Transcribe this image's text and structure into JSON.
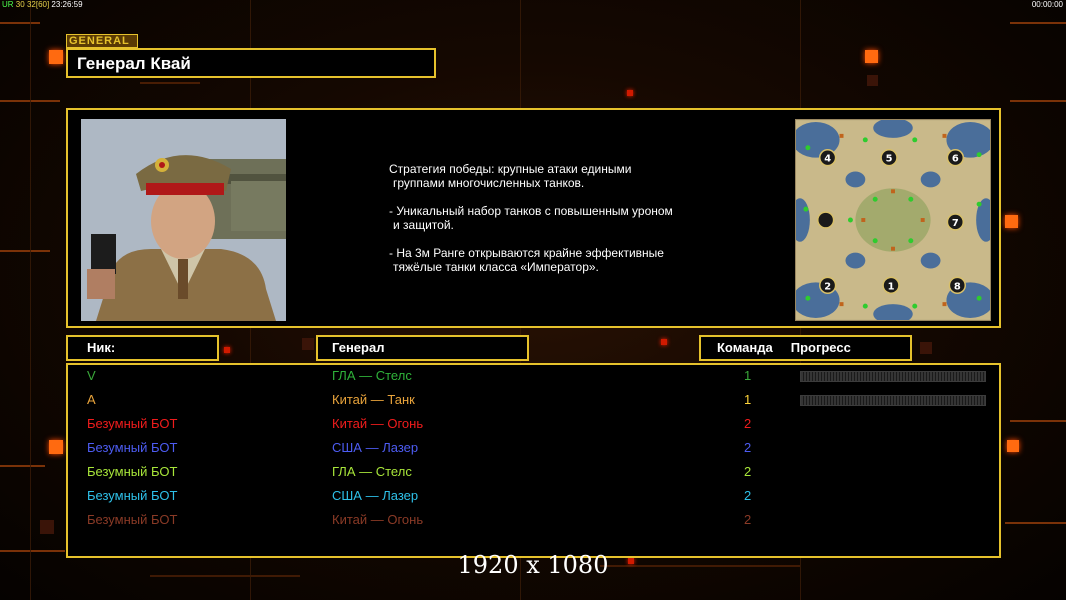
{
  "hud": {
    "counter_label": "UR",
    "counter_a": "30",
    "counter_b": "32",
    "counter_c": "[60]",
    "clock": "23:26:59",
    "timer": "00:00:00"
  },
  "general": {
    "tag": "GENERAL",
    "name": "Генерал Квай",
    "description": [
      [
        "Стратегия победы: крупные атаки едиными",
        " группами многочисленных танков."
      ],
      [
        "- Уникальный набор танков с повышенным уроном",
        " и защитой."
      ],
      [
        "- На 3м Ранге открываются крайне эффективные",
        " тяжёлые танки класса «Император»."
      ]
    ]
  },
  "minimap": {
    "slots": [
      "4",
      "5",
      "6",
      "7",
      "2",
      "1",
      "8"
    ]
  },
  "table": {
    "headers": {
      "nick": "Ник:",
      "general": "Генерал",
      "team": "Команда",
      "progress": "Прогресс"
    },
    "players": [
      {
        "nick": "V",
        "general": "ГЛА — Стелс",
        "team": "1",
        "color": "#3aa83a",
        "gen_color": "#2fb23a",
        "progress": 0,
        "show_progress": true
      },
      {
        "nick": "A",
        "general": "Китай — Танк",
        "team": "1",
        "color": "#e8a33b",
        "gen_color": "#e8a33b",
        "team_color": "#ffd43a",
        "progress": 0,
        "show_progress": true
      },
      {
        "nick": "Безумный БОТ",
        "general": "Китай — Огонь",
        "team": "2",
        "color": "#f01c1c",
        "gen_color": "#f01c1c",
        "show_progress": false
      },
      {
        "nick": "Безумный БОТ",
        "general": "США — Лазер",
        "team": "2",
        "color": "#4d5cf2",
        "gen_color": "#4d5cf2",
        "show_progress": false
      },
      {
        "nick": "Безумный БОТ",
        "general": "ГЛА — Стелс",
        "team": "2",
        "color": "#a8e63a",
        "gen_color": "#a8e63a",
        "show_progress": false
      },
      {
        "nick": "Безумный БОТ",
        "general": "США — Лазер",
        "team": "2",
        "color": "#2ec0e8",
        "gen_color": "#2ec0e8",
        "show_progress": false
      },
      {
        "nick": "Безумный БОТ",
        "general": "Китай — Огонь",
        "team": "2",
        "color": "#8a3a26",
        "gen_color": "#8a3a26",
        "show_progress": false
      }
    ]
  },
  "resolution": "1920 x 1080"
}
